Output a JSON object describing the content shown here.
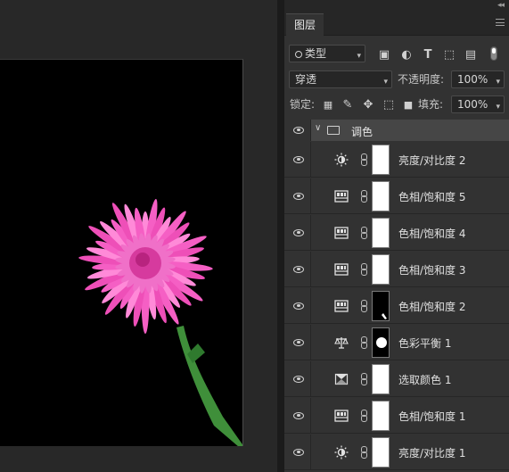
{
  "layers_panel": {
    "tab_label": "图层",
    "filter": {
      "selected": "类型",
      "icons": [
        "image-filter-icon",
        "adjustment-filter-icon",
        "type-filter-icon",
        "shape-filter-icon",
        "smart-object-filter-icon",
        "filter-toggle-icon"
      ]
    },
    "blend_mode": "穿透",
    "opacity_label": "不透明度:",
    "opacity_value": "100%",
    "lock_label": "锁定:",
    "lock_icons": [
      "lock-transparent-icon",
      "lock-paint-icon",
      "lock-position-icon",
      "lock-artboard-icon",
      "lock-all-icon"
    ],
    "fill_label": "填充:",
    "fill_value": "100%",
    "group": {
      "name": "调色"
    },
    "layers": [
      {
        "name": "亮度/对比度 2",
        "icon": "brightness-contrast-icon",
        "mask": "white"
      },
      {
        "name": "色相/饱和度 5",
        "icon": "hue-saturation-icon",
        "mask": "white"
      },
      {
        "name": "色相/饱和度 4",
        "icon": "hue-saturation-icon",
        "mask": "white"
      },
      {
        "name": "色相/饱和度 3",
        "icon": "hue-saturation-icon",
        "mask": "white"
      },
      {
        "name": "色相/饱和度 2",
        "icon": "hue-saturation-icon",
        "mask": "black"
      },
      {
        "name": "色彩平衡 1",
        "icon": "color-balance-icon",
        "mask": "black-white-shape"
      },
      {
        "name": "选取颜色 1",
        "icon": "selective-color-icon",
        "mask": "white"
      },
      {
        "name": "色相/饱和度 1",
        "icon": "hue-saturation-icon",
        "mask": "white"
      },
      {
        "name": "亮度/对比度 1",
        "icon": "brightness-contrast-icon",
        "mask": "white"
      }
    ]
  },
  "colors": {
    "flower": "#ff66cc",
    "stem": "#3f8f3a",
    "panel_bg": "#323232"
  }
}
